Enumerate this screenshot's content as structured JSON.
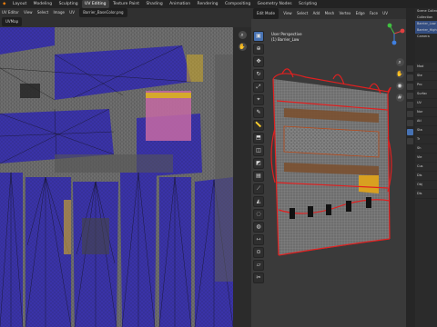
{
  "app": {
    "logo": "◆",
    "workspace_tabs": [
      "Layout",
      "Modeling",
      "Sculpting",
      "UV Editing",
      "Texture Paint",
      "Shading",
      "Animation",
      "Rendering",
      "Compositing",
      "Geometry Nodes",
      "Scripting"
    ],
    "active_tab": "UV Editing"
  },
  "uv_editor": {
    "mode": "UV Editor",
    "view_label": "View",
    "select_label": "Select",
    "image_label": "Image",
    "uv_label": "UV",
    "image_name": "Barrier_BaseColor.png",
    "uvmap_label": "UVMap",
    "colors": {
      "island_fill": "#3a33a8",
      "wire": "#111111",
      "texture_gray": "#6f6f6f",
      "accent_yellow": "#d8b020",
      "accent_pink": "#c56aa3"
    }
  },
  "viewport": {
    "mode": "Edit Mode",
    "menus": [
      "View",
      "Select",
      "Add",
      "Mesh",
      "Vertex",
      "Edge",
      "Face",
      "UV"
    ],
    "options_label": "Options",
    "perspective_text": "User Perspective",
    "object_text": "(1) Barrier_Low",
    "colors": {
      "mesh_red": "#e02020",
      "mesh_body": "#7a7a7a",
      "background": "#3a3a3a"
    }
  },
  "outliner": {
    "items": [
      "Scene Collection",
      "Collection",
      "Barrier_Low",
      "Barrier_High",
      "Camera"
    ]
  },
  "properties": {
    "rows": [
      "Mod",
      "Ste",
      "Pro",
      "Surfac",
      "UV",
      "Nor",
      "Atl",
      "Sta",
      "Tr",
      "Sh",
      "Vie",
      "Cus",
      "Dis",
      "Obj",
      "Dis"
    ]
  }
}
